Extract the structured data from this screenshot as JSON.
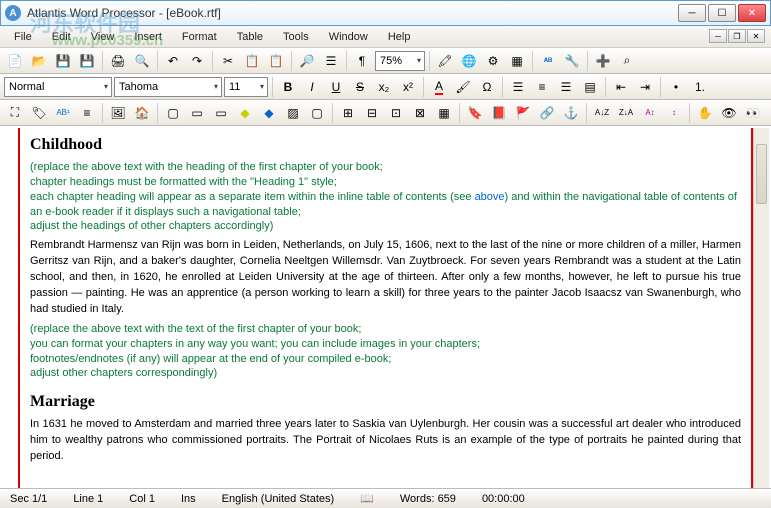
{
  "window": {
    "title": "Atlantis Word Processor - [eBook.rtf]",
    "icon_letter": "A"
  },
  "watermark": {
    "text1": "河东软件园",
    "text2": "www.pc0359.cn"
  },
  "menus": [
    "File",
    "Edit",
    "View",
    "Insert",
    "Format",
    "Table",
    "Tools",
    "Window",
    "Help"
  ],
  "format": {
    "style": "Normal",
    "font": "Tahoma",
    "size": "11",
    "zoom": "75%"
  },
  "toolbar1_icons": [
    "new",
    "open",
    "save",
    "saveall",
    "print",
    "preview",
    "undo",
    "redo",
    "cut",
    "copy",
    "paste",
    "find",
    "view-list",
    "pilcrow"
  ],
  "toolbar1_right": [
    "highlight",
    "globe",
    "macro",
    "border",
    "spellcheck",
    "tools",
    "more1",
    "more2"
  ],
  "toolbar2_btns": {
    "bold": "B",
    "italic": "I",
    "underline": "U",
    "strike": "S",
    "sub": "x₂",
    "sup": "x²"
  },
  "toolbar2_icons": [
    "font-color",
    "back-color",
    "char",
    "align-left",
    "align-center",
    "align-right",
    "align-justify",
    "indent-dec",
    "indent-inc",
    "bullets",
    "numbers"
  ],
  "toolbar3_icons": [
    "fullscreen",
    "tag",
    "abc",
    "lines",
    "sep",
    "img",
    "house",
    "sep",
    "box",
    "sq1",
    "sq2",
    "fill-y",
    "fill-b",
    "fill-h",
    "fill-n",
    "sep",
    "cell1",
    "cell2",
    "cell3",
    "cell4",
    "tbl",
    "sep",
    "bmk",
    "book",
    "flag",
    "link",
    "anchor",
    "sep",
    "sort-az",
    "sort-za",
    "style-goto",
    "goto",
    "sep",
    "hand",
    "eye",
    "eye2"
  ],
  "document": {
    "h1": "Childhood",
    "g1": "(replace the above text with the heading of the first chapter of your book;",
    "g2": "chapter headings must be formatted with the \"Heading 1\" style;",
    "g3a": "each chapter heading will appear as a separate item within the inline table of contents (see ",
    "g3b": "above",
    "g3c": ") and within the navigational table of contents of an e-book reader if it displays such a navigational table;",
    "g4": "adjust the headings of other chapters accordingly)",
    "p1": "Rembrandt Harmensz van Rijn was born in Leiden, Netherlands, on July 15, 1606, next to the last of the nine or more children of a miller, Harmen Gerritsz van Rijn, and a baker's daughter, Cornelia Neeltgen Willemsdr. Van Zuytbroeck. For seven years Rembrandt was a student at the Latin school, and then, in 1620, he enrolled at Leiden University at the age of thirteen. After only a few months, however, he left to pursue his true passion — painting. He was an apprentice (a person working to learn a skill) for three years to the painter Jacob Isaacsz van Swanenburgh, who had studied in Italy.",
    "g5": "(replace the above text with the text of the first chapter of your book;",
    "g6": "you can format your chapters in any way you want; you can include images in your chapters;",
    "g7": "footnotes/endnotes (if any) will appear at the end of your compiled e-book;",
    "g8": "adjust other chapters correspondingly)",
    "h2": "Marriage",
    "p2": "In 1631 he moved to Amsterdam and married three years later to Saskia van Uylenburgh. Her cousin was a successful art dealer who introduced him to wealthy patrons who commissioned portraits. The Portrait of Nicolaes Ruts is an example of the type of portraits he painted during that period."
  },
  "status": {
    "sec": "Sec 1/1",
    "line": "Line 1",
    "col": "Col 1",
    "ins": "Ins",
    "lang": "English (United States)",
    "words": "Words: 659",
    "time": "00:00:00"
  }
}
